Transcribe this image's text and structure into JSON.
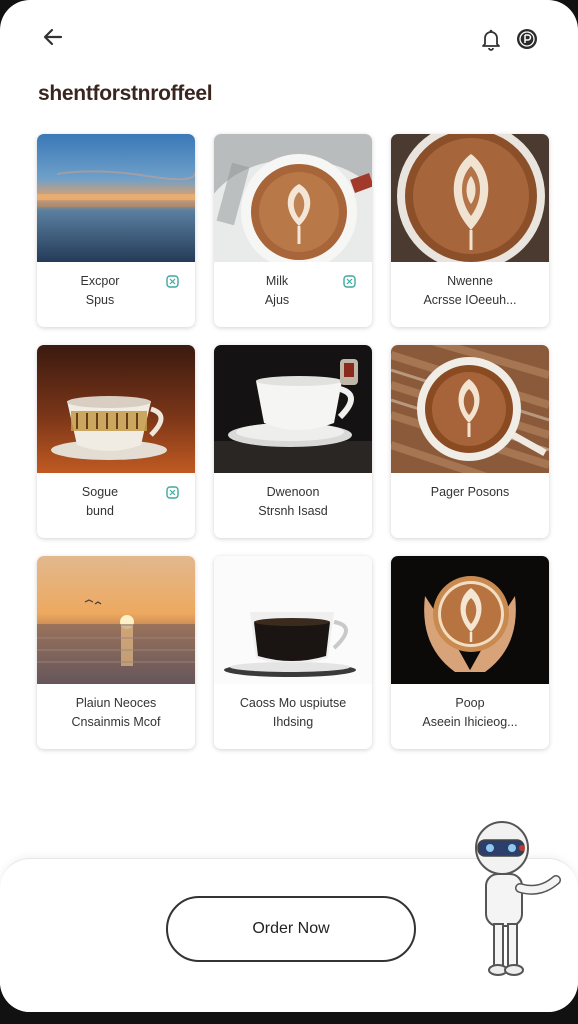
{
  "header": {
    "title": "shentforstnroffeel",
    "back_icon": "arrow-left-icon",
    "bell_icon": "bell-icon",
    "profile_icon": "user-circle-icon"
  },
  "cards": [
    {
      "line1": "Excpor",
      "line2": "Spus",
      "badge": true,
      "image": "sunset-sea"
    },
    {
      "line1": "Milk",
      "line2": "Ajus",
      "badge": true,
      "image": "latte-art-cup"
    },
    {
      "line1": "Nwenne",
      "line2": "Acrsse IOeeuh...",
      "badge": false,
      "image": "latte-art-closeup"
    },
    {
      "line1": "Sogue",
      "line2": "bund",
      "badge": true,
      "image": "patterned-teacup"
    },
    {
      "line1": "Dwenoon",
      "line2": "Strsnh Isasd",
      "badge": false,
      "image": "white-cup-dark"
    },
    {
      "line1": "Pager Posons",
      "line2": "",
      "badge": false,
      "image": "latte-on-wood"
    },
    {
      "line1": "Plaiun Neoces",
      "line2": "Cnsainmis Mcof",
      "badge": false,
      "image": "sunset-ocean"
    },
    {
      "line1": "Caoss Mo uspiutse",
      "line2": "Ihdsing",
      "badge": false,
      "image": "espresso-glass-cup"
    },
    {
      "line1": "Poop",
      "line2": "Aseein Ihicieog...",
      "badge": false,
      "image": "hands-latte"
    }
  ],
  "order_button": {
    "label": "Order Now"
  },
  "colors": {
    "accent": "#3fa9a0",
    "title": "#3a2620",
    "coffee": "#9a5a32"
  }
}
